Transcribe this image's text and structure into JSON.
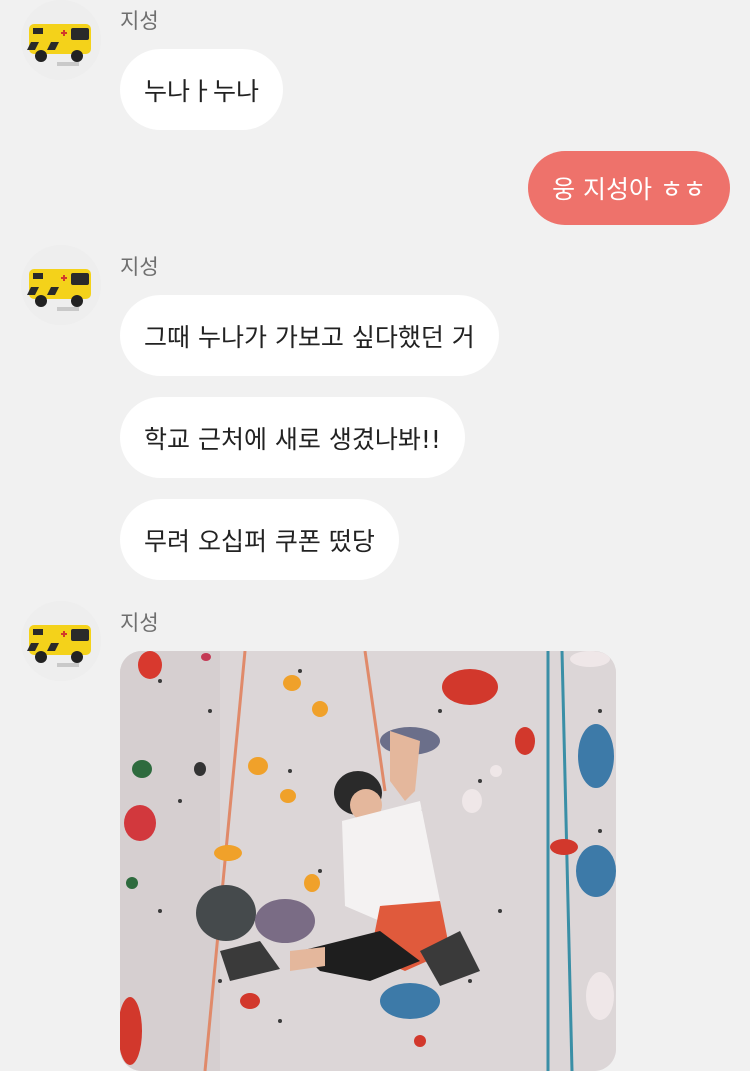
{
  "chat": {
    "sender_name": "지성",
    "groups": [
      {
        "messages": [
          "누나ㅏ누나"
        ]
      },
      {
        "messages": [
          "그때 누나가 가보고 싶다했던 거",
          "학교 근처에 새로 생겼나봐!!",
          "무려 오십퍼 쿠폰 떴당"
        ]
      }
    ],
    "my_messages": [
      "웅 지성아 ㅎㅎ"
    ]
  },
  "colors": {
    "background": "#f1f1f1",
    "incoming_bubble": "#ffffff",
    "outgoing_bubble": "#ee726b",
    "sender_name": "#6f6f6f"
  },
  "icons": {
    "avatar": "ambulance-toy-avatar",
    "photo": "climbing-wall-photo"
  }
}
